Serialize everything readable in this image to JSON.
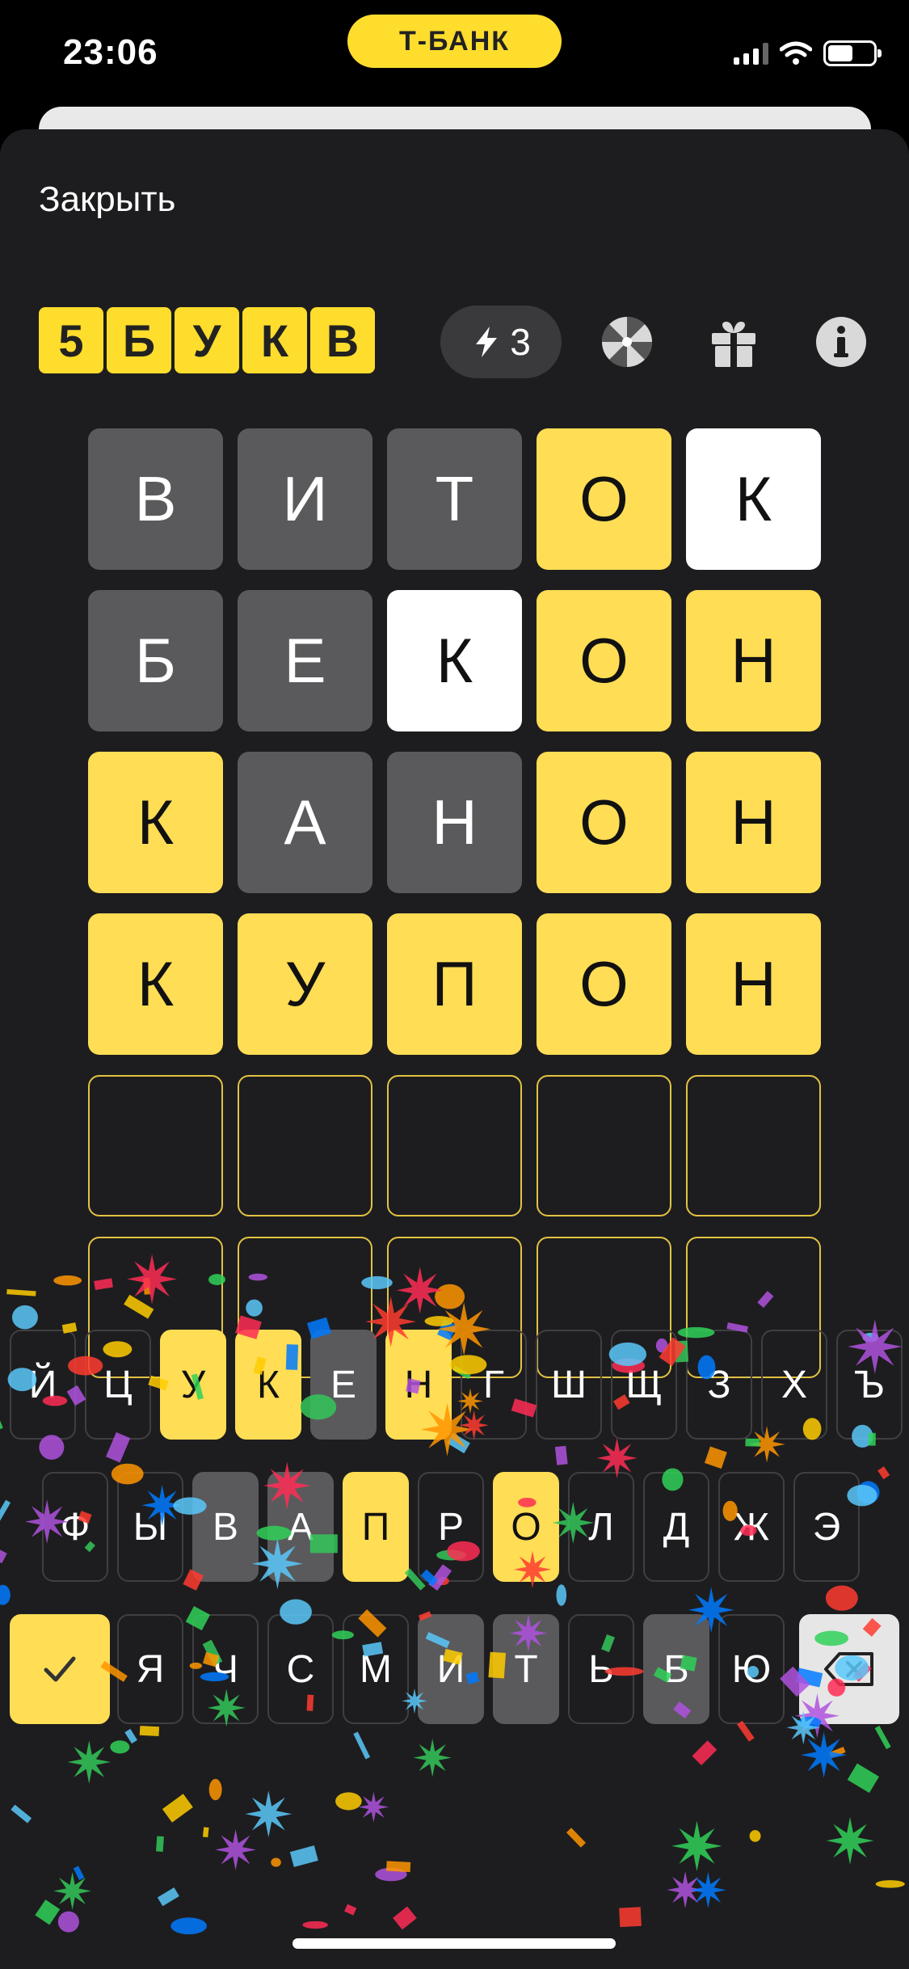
{
  "status": {
    "time": "23:06",
    "pill_label": "Т-БАНК"
  },
  "sheet": {
    "close_label": "Закрыть"
  },
  "header": {
    "logo_letters": [
      "5",
      "Б",
      "У",
      "К",
      "В"
    ],
    "energy_count": "3",
    "icons": [
      "lightning-icon",
      "wheel-icon",
      "gift-icon",
      "info-icon"
    ]
  },
  "board": {
    "rows": [
      [
        {
          "l": "В",
          "s": "absent"
        },
        {
          "l": "И",
          "s": "absent"
        },
        {
          "l": "Т",
          "s": "absent"
        },
        {
          "l": "О",
          "s": "correct"
        },
        {
          "l": "К",
          "s": "present"
        }
      ],
      [
        {
          "l": "Б",
          "s": "absent"
        },
        {
          "l": "Е",
          "s": "absent"
        },
        {
          "l": "К",
          "s": "present"
        },
        {
          "l": "О",
          "s": "correct"
        },
        {
          "l": "Н",
          "s": "correct"
        }
      ],
      [
        {
          "l": "К",
          "s": "correct"
        },
        {
          "l": "А",
          "s": "absent"
        },
        {
          "l": "Н",
          "s": "absent"
        },
        {
          "l": "О",
          "s": "correct"
        },
        {
          "l": "Н",
          "s": "correct"
        }
      ],
      [
        {
          "l": "К",
          "s": "correct"
        },
        {
          "l": "У",
          "s": "correct"
        },
        {
          "l": "П",
          "s": "correct"
        },
        {
          "l": "О",
          "s": "correct"
        },
        {
          "l": "Н",
          "s": "correct"
        }
      ],
      [
        {
          "l": "",
          "s": "empty"
        },
        {
          "l": "",
          "s": "empty"
        },
        {
          "l": "",
          "s": "empty"
        },
        {
          "l": "",
          "s": "empty"
        },
        {
          "l": "",
          "s": "empty"
        }
      ],
      [
        {
          "l": "",
          "s": "empty"
        },
        {
          "l": "",
          "s": "empty"
        },
        {
          "l": "",
          "s": "empty"
        },
        {
          "l": "",
          "s": "empty"
        },
        {
          "l": "",
          "s": "empty"
        }
      ]
    ]
  },
  "keyboard": {
    "rows": [
      [
        {
          "k": "Й",
          "s": ""
        },
        {
          "k": "Ц",
          "s": ""
        },
        {
          "k": "У",
          "s": "correct"
        },
        {
          "k": "К",
          "s": "correct"
        },
        {
          "k": "Е",
          "s": "absent"
        },
        {
          "k": "Н",
          "s": "correct"
        },
        {
          "k": "Г",
          "s": ""
        },
        {
          "k": "Ш",
          "s": ""
        },
        {
          "k": "Щ",
          "s": ""
        },
        {
          "k": "З",
          "s": ""
        },
        {
          "k": "Х",
          "s": ""
        },
        {
          "k": "Ъ",
          "s": ""
        }
      ],
      [
        {
          "k": "Ф",
          "s": ""
        },
        {
          "k": "Ы",
          "s": ""
        },
        {
          "k": "В",
          "s": "absent"
        },
        {
          "k": "А",
          "s": "absent"
        },
        {
          "k": "П",
          "s": "correct"
        },
        {
          "k": "Р",
          "s": ""
        },
        {
          "k": "О",
          "s": "correct"
        },
        {
          "k": "Л",
          "s": ""
        },
        {
          "k": "Д",
          "s": ""
        },
        {
          "k": "Ж",
          "s": ""
        },
        {
          "k": "Э",
          "s": ""
        }
      ],
      [
        {
          "k": "Я",
          "s": ""
        },
        {
          "k": "Ч",
          "s": ""
        },
        {
          "k": "С",
          "s": ""
        },
        {
          "k": "М",
          "s": ""
        },
        {
          "k": "И",
          "s": "absent"
        },
        {
          "k": "Т",
          "s": "absent"
        },
        {
          "k": "Ь",
          "s": ""
        },
        {
          "k": "Б",
          "s": "absent"
        },
        {
          "k": "Ю",
          "s": ""
        }
      ]
    ],
    "enter_icon": "check-icon",
    "backspace_icon": "backspace-icon"
  },
  "colors": {
    "accent": "#ffdd55",
    "absent": "#5a5a5c",
    "present": "#ffffff",
    "background": "#1d1d1f"
  }
}
